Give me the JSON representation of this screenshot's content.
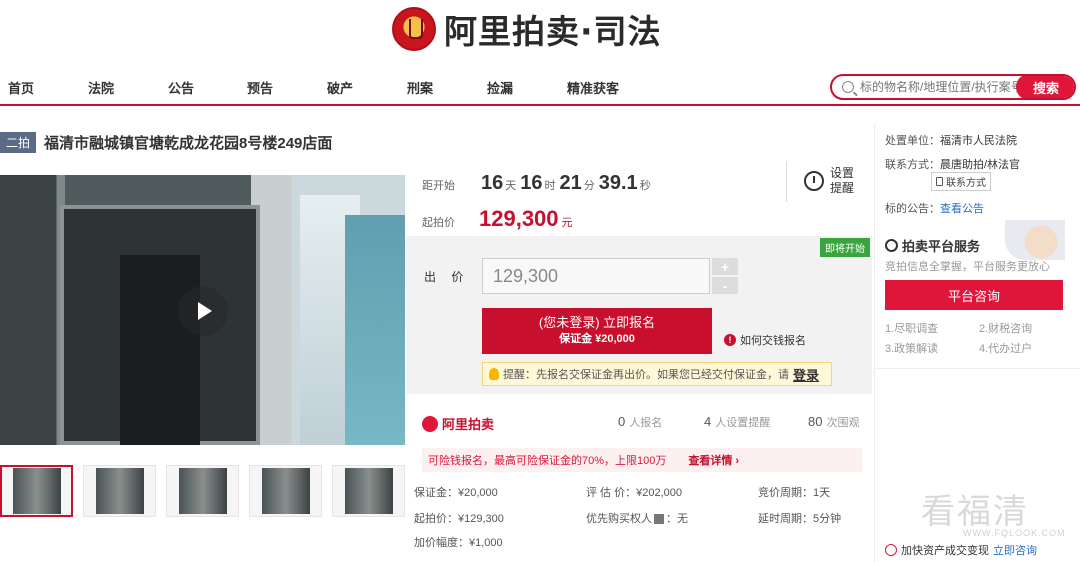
{
  "brand": {
    "name": "阿里拍卖·司法"
  },
  "nav": {
    "items": [
      "首页",
      "法院",
      "公告",
      "预告",
      "破产",
      "刑案",
      "捡漏",
      "精准获客"
    ]
  },
  "search": {
    "placeholder": "标的物名称/地理位置/执行案号",
    "button": "搜索"
  },
  "lot": {
    "round": "二拍",
    "title": "福清市融城镇官塘乾成龙花园8号楼249店面"
  },
  "countdown": {
    "label": "距开始",
    "days": "16",
    "days_unit": "天",
    "hours": "16",
    "hours_unit": "时",
    "minutes": "21",
    "minutes_unit": "分",
    "seconds": "39.1",
    "seconds_unit": "秒"
  },
  "remind": {
    "label": "设置提醒"
  },
  "start": {
    "label": "起拍价",
    "price": "129,300",
    "unit": "元"
  },
  "bid": {
    "soon_tag": "即将开始",
    "label": "出 价",
    "value": "129,300",
    "plus": "+",
    "minus": "-",
    "register_line1": "(您未登录) 立即报名",
    "register_line2": "保证金 ¥20,000",
    "howto": "如何交钱报名",
    "tip_text": "提醒：先报名交保证金再出价。如果您已经交付保证金，请",
    "tip_login": "登录"
  },
  "stats": {
    "logo": "阿里拍卖",
    "signups": "0",
    "signups_label": "人报名",
    "reminders": "4",
    "reminders_label": "人设置提醒",
    "views": "80",
    "views_label": "次围观"
  },
  "loan": {
    "text": "可险钱报名，最高可险保证金的70%，上限100万",
    "more": "查看详情 ›"
  },
  "details": {
    "deposit": "保证金：¥20,000",
    "appraisal": "评 估 价：¥202,000",
    "cycle": "竞价周期：1天",
    "start_price": "起拍价：¥129,300",
    "priority": "优先购买权人",
    "priority_value": "：无",
    "extend": "延时周期：5分钟",
    "increment": "加价幅度：¥1,000"
  },
  "sidebar": {
    "unit_label": "处置单位：",
    "unit_value": "福清市人民法院",
    "contact_label": "联系方式：",
    "contact_value": "晨唐助拍/林法官",
    "contact_btn": "联系方式",
    "notice_label": "标的公告：",
    "notice_link": "查看公告",
    "service_title": "拍卖平台服务",
    "service_sub": "竞拍信息全掌握，平台服务更放心",
    "consult_btn": "平台咨询",
    "services": [
      "1.尽职调查",
      "2.财税咨询",
      "3.政策解读",
      "4.代办过户"
    ],
    "asset_text": "加快资产成交变现",
    "asset_link": "立即咨询",
    "watermark": "看福清",
    "watermark_url": "WWW.FQLOOK.COM"
  }
}
